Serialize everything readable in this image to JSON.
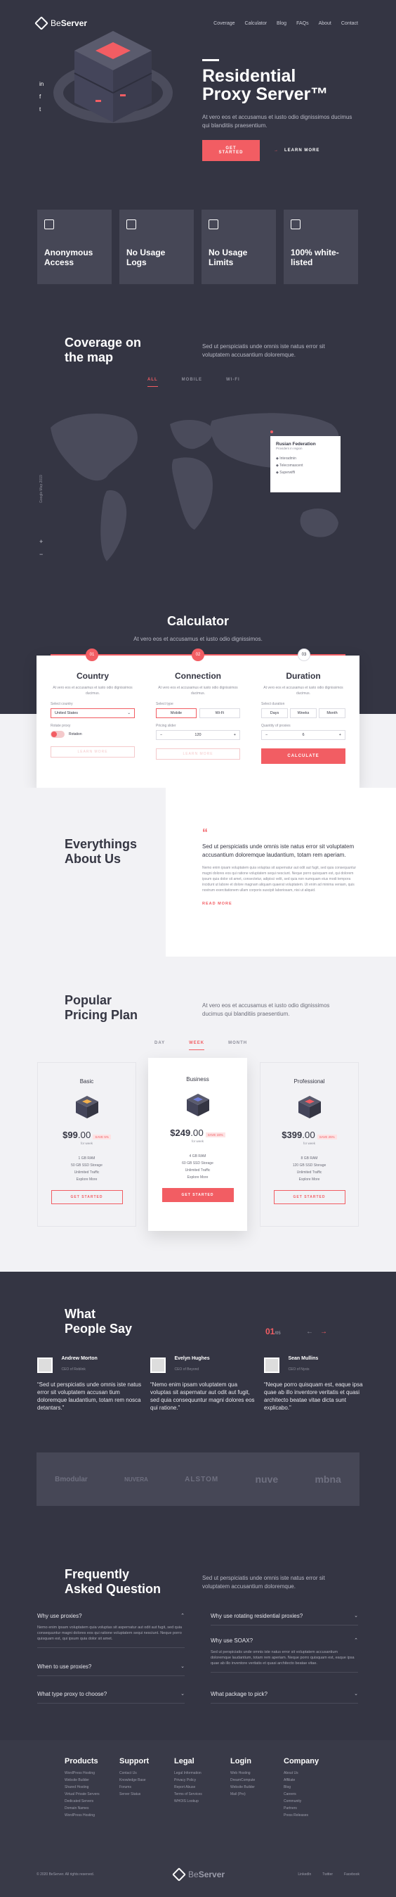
{
  "brand": {
    "name_light": "Be",
    "name_bold": "Server"
  },
  "nav": [
    "Coverage",
    "Calculator",
    "Blog",
    "FAQs",
    "About",
    "Contact"
  ],
  "hero": {
    "title": "Residential\nProxy Server™",
    "desc": "At vero eos et accusamus et iusto odio dignissimos ducimus qui blanditiis praesentium.",
    "cta": "GET STARTED",
    "learn": "LEARN MORE",
    "social": [
      "in",
      "f",
      "t"
    ]
  },
  "features": [
    {
      "icon": "user-card-icon",
      "title": "Anonymous\nAccess"
    },
    {
      "icon": "folder-icon",
      "title": "No Usage\nLogs"
    },
    {
      "icon": "monitor-icon",
      "title": "No Usage\nLimits"
    },
    {
      "icon": "list-icon",
      "title": "100% white-\nlisted"
    }
  ],
  "coverage": {
    "title": "Coverage on\nthe map",
    "desc": "Sed ut perspiciatis unde omnis iste natus error sit voluptatem accusantium doloremque.",
    "tabs": [
      "ALL",
      "MOBILE",
      "WI-FI"
    ],
    "popup": {
      "country": "Rusian Federation",
      "sub": "Providers in region",
      "items": [
        "Interadmin",
        "Telecomascent",
        "Superwiffi"
      ]
    },
    "vertical": "Google Map 2019",
    "zoom_in": "+",
    "zoom_out": "−"
  },
  "calculator": {
    "title": "Calculator",
    "desc": "At vero eos et accusamus et iusto odio dignissimos.",
    "steps": [
      "01",
      "02",
      "03"
    ],
    "cols": [
      {
        "title": "Country",
        "desc": "At vero eos et accusamus et iusto odio dignissimos ducimus.",
        "label": "Select country",
        "value": "United States",
        "label2": "Rotate proxy",
        "value2": "Rotation"
      },
      {
        "title": "Connection",
        "desc": "At vero eos et accusamus et iusto odio dignissimos ducimus.",
        "label": "Select type",
        "opts": [
          "Mobile",
          "Wi-Fi"
        ],
        "label2": "Pricing slider",
        "value2": "120"
      },
      {
        "title": "Duration",
        "desc": "At vero eos et accusamus et iusto odio dignissimos ducimus.",
        "label": "Select duration",
        "opts": [
          "Days",
          "Weeks",
          "Month"
        ],
        "label2": "Quantity of proxies",
        "value2": "6"
      }
    ],
    "ghost": "LEARN MORE",
    "ghost2": "LEARN MORE",
    "calc_btn": "CALCULATE"
  },
  "about": {
    "title": "Everythings\nAbout Us",
    "quote": "Sed ut perspiciatis unde omnis iste natus error sit voluptatem accusantium doloremque laudantium, totam rem aperiam.",
    "body": "Nemo enim ipsam voluptatem quia voluptas sit aspernatur aut odit aut fugit, sed quia consequuntur magni dolores eos qui ratione voluptatem sequi nesciunt. Neque porro quisquam est, qui dolorem ipsum quia dolor sit amet, consectetur, adipisci velit, sed quia non numquam eius modi tempora incidunt ut labore et dolore magnam aliquam quaerat voluptatem. Ut enim ad minima veniam, quis nostrum exercitationem ullam corporis suscipit laboriosam, nisi ut aliquid.",
    "more": "READ MORE"
  },
  "pricing": {
    "title": "Popular\nPricing Plan",
    "desc": "At vero eos et accusamus et iusto odio dignissimos ducimus qui blanditiis praesentium.",
    "tabs": [
      "DAY",
      "WEEK",
      "MONTH"
    ],
    "plans": [
      {
        "name": "Basic",
        "price": "$99",
        "per": ".00",
        "tag": "SAVE 5%",
        "note": "for week",
        "f": [
          "1 GB RAM",
          "50 GB SSD Storage",
          "Unlimited Traffic",
          "Explore More"
        ],
        "btn": "GET STARTED"
      },
      {
        "name": "Business",
        "price": "$249",
        "per": ".00",
        "tag": "SAVE 15%",
        "note": "for week",
        "f": [
          "4 GB RAM",
          "60 GB SSD Storage",
          "Unlimited Traffic",
          "Explore More"
        ],
        "btn": "GET STARTED"
      },
      {
        "name": "Professional",
        "price": "$399",
        "per": ".00",
        "tag": "SAVE 25%",
        "note": "for week",
        "f": [
          "8 GB RAM",
          "120 GB SSD Storage",
          "Unlimited Traffic",
          "Explore More"
        ],
        "btn": "GET STARTED"
      }
    ]
  },
  "testimonials": {
    "title": "What\nPeople Say",
    "counter": "01",
    "counter_total": "/05",
    "people": [
      {
        "name": "Andrew Morton",
        "role": "CEO of Reblink",
        "quote": "“Sed ut perspiciatis unde omnis iste natus error sit voluptatem accusan tium doloremque laudantium, totam rem nosca detantars.”"
      },
      {
        "name": "Evelyn Hughes",
        "role": "CEO of Beyond",
        "quote": "“Nemo enim ipsam voluptatem qua voluptas sit aspernatur aut odit aut fugit, sed quia consequuntur magni dolores eos qui ratione.”"
      },
      {
        "name": "Sean Mullins",
        "role": "CEO of Nyxis",
        "quote": "“Neque porro quisquam est, eaque ipsa quae ab illo inventore veritatis et quasi architecto beatae vitae dicta sunt explicabo.”"
      }
    ],
    "logos": [
      "Bmodular",
      "NUVERA",
      "ALSTOM",
      "nuve",
      "mbna"
    ]
  },
  "faq": {
    "title": "Frequently\nAsked Question",
    "desc": "Sed ut perspiciatis unde omnis iste natus error sit voluptatem accusantium doloremque.",
    "items": [
      {
        "q": "Why use proxies?",
        "a": "Nemo enim ipsam voluptatem quia voluptas sit aspernatur aut odit aut fugit, sed quia consequuntur magni dolores eos qui ratione voluptatem sequi nesciunt. Neque porro quisquam est, qui ipsum quia dolor sit amet."
      },
      {
        "q": "Why use rotating residential proxies?",
        "a": ""
      },
      {
        "q": "Why use SOAX?",
        "a": "Sed ut perspiciatis unde omnis iste natus error sit voluptatem accusantium doloremque laudantium, totam rem aperiam. Neque porro quisquam est, eaque ipsa quae ab illo inventore veritatis et quasi architecto beatae vitae."
      },
      {
        "q": "When to use proxies?",
        "a": ""
      },
      {
        "q": "What type proxy to choose?",
        "a": ""
      },
      {
        "q": "What package to pick?",
        "a": ""
      }
    ]
  },
  "footer": {
    "cols": [
      {
        "title": "Products",
        "items": [
          "WordPress Hosting",
          "Website Builder",
          "Shared Hosting",
          "Virtual Private Servers",
          "Dedicated Servers",
          "Domain Names",
          "WordPress Hosting"
        ]
      },
      {
        "title": "Support",
        "items": [
          "Contact Us",
          "Knowledge Base",
          "Forums",
          "Server Status"
        ]
      },
      {
        "title": "Legal",
        "items": [
          "Legal Information",
          "Privacy Policy",
          "Report Abuse",
          "Terms of Services",
          "WHOIS Lookup"
        ]
      },
      {
        "title": "Login",
        "items": [
          "Web Hosting",
          "DreamCompute",
          "Website Builder",
          "Mail (Pro)"
        ]
      },
      {
        "title": "Company",
        "items": [
          "About Us",
          "Affiliate",
          "Blog",
          "Careers",
          "Community",
          "Partners",
          "Press Releases"
        ]
      }
    ],
    "copy": "© 2020 BeServer. All rights reserved.",
    "social": [
      "LinkedIn",
      "Twitter",
      "Facebook"
    ]
  },
  "colors": {
    "accent": "#f25d63",
    "bg_dark": "#343543",
    "bg_light": "#f2f2f5"
  }
}
